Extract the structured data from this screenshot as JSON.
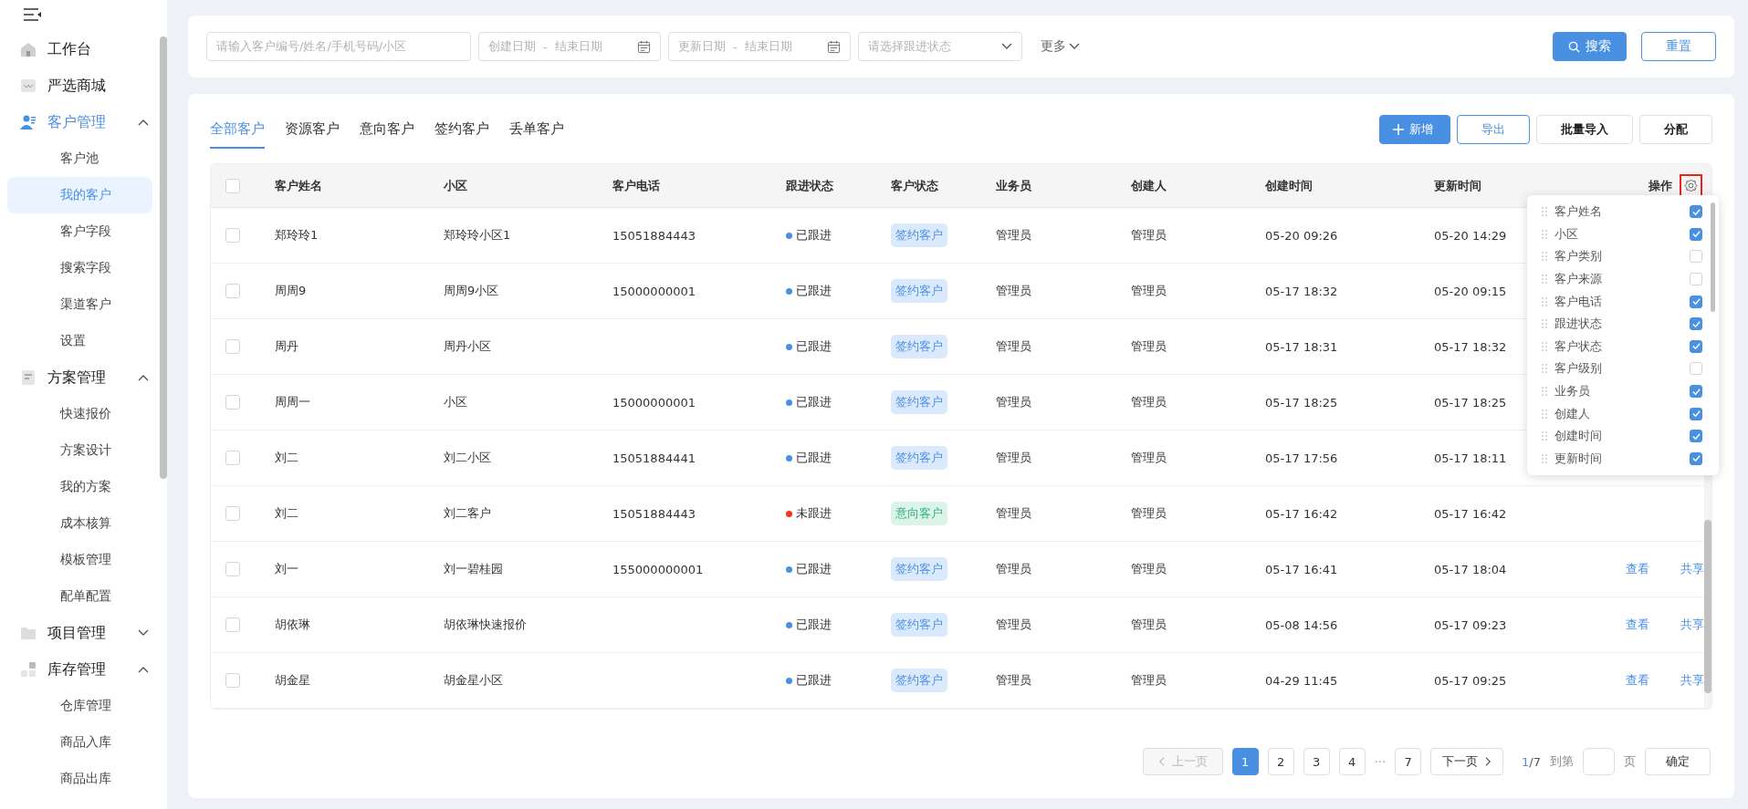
{
  "sidebar": {
    "items": [
      {
        "label": "工作台"
      },
      {
        "label": "严选商城"
      },
      {
        "label": "客户管理",
        "active": true,
        "expanded": true,
        "children": [
          {
            "label": "客户池",
            "selected": false
          },
          {
            "label": "我的客户",
            "selected": true
          },
          {
            "label": "客户字段",
            "selected": false
          },
          {
            "label": "搜索字段",
            "selected": false
          },
          {
            "label": "渠道客户",
            "selected": false
          },
          {
            "label": "设置",
            "selected": false
          }
        ]
      },
      {
        "label": "方案管理",
        "active": false,
        "expanded": true,
        "children": [
          {
            "label": "快速报价",
            "selected": false
          },
          {
            "label": "方案设计",
            "selected": false
          },
          {
            "label": "我的方案",
            "selected": false
          },
          {
            "label": "成本核算",
            "selected": false
          },
          {
            "label": "模板管理",
            "selected": false
          },
          {
            "label": "配单配置",
            "selected": false
          }
        ]
      },
      {
        "label": "项目管理",
        "active": false,
        "expanded": false
      },
      {
        "label": "库存管理",
        "active": false,
        "expanded": true,
        "children": [
          {
            "label": "仓库管理",
            "selected": false
          },
          {
            "label": "商品入库",
            "selected": false
          },
          {
            "label": "商品出库",
            "selected": false
          }
        ]
      }
    ]
  },
  "filters": {
    "search": {
      "placeholder": "请输入客户编号/姓名/手机号码/小区"
    },
    "date_ranges": [
      {
        "start_placeholder": "创建日期",
        "separator": "-",
        "end_placeholder": "结束日期"
      },
      {
        "start_placeholder": "更新日期",
        "separator": "-",
        "end_placeholder": "结束日期"
      }
    ],
    "status_select": {
      "placeholder": "请选择跟进状态"
    },
    "more": "更多",
    "search_button": "搜索",
    "reset_button": "重置"
  },
  "tabs": [
    {
      "label": "全部客户",
      "selected": true
    },
    {
      "label": "资源客户",
      "selected": false
    },
    {
      "label": "意向客户",
      "selected": false
    },
    {
      "label": "签约客户",
      "selected": false
    },
    {
      "label": "丢单客户",
      "selected": false
    }
  ],
  "actions": [
    {
      "label": "新增",
      "kind": "primary"
    },
    {
      "label": "导出",
      "kind": "outline"
    },
    {
      "label": "批量导入",
      "kind": "default"
    },
    {
      "label": "分配",
      "kind": "default"
    }
  ],
  "table": {
    "all_checked": false,
    "columns": [
      "客户姓名",
      "小区",
      "客户电话",
      "跟进状态",
      "客户状态",
      "业务员",
      "创建人",
      "创建时间",
      "更新时间",
      "操作"
    ],
    "rows": [
      {
        "checked": false,
        "name": "郑玲玲1",
        "community": "郑玲玲小区1",
        "phone": "15051884443",
        "follow": {
          "label": "已跟进",
          "color": "#4a90e2"
        },
        "status": {
          "label": "签约客户",
          "kind": "signed"
        },
        "salesperson": "管理员",
        "creator": "管理员",
        "created": "05-20 09:26",
        "updated": "05-20 14:29"
      },
      {
        "checked": false,
        "name": "周周9",
        "community": "周周9小区",
        "phone": "15000000001",
        "follow": {
          "label": "已跟进",
          "color": "#4a90e2"
        },
        "status": {
          "label": "签约客户",
          "kind": "signed"
        },
        "salesperson": "管理员",
        "creator": "管理员",
        "created": "05-17 18:32",
        "updated": "05-20 09:15"
      },
      {
        "checked": false,
        "name": "周丹",
        "community": "周丹小区",
        "follow": {
          "label": "已跟进",
          "color": "#4a90e2"
        },
        "status": {
          "label": "签约客户",
          "kind": "signed"
        },
        "salesperson": "管理员",
        "creator": "管理员",
        "created": "05-17 18:31",
        "updated": "05-17 18:32"
      },
      {
        "checked": false,
        "name": "周周一",
        "community": "小区",
        "phone": "15000000001",
        "follow": {
          "label": "已跟进",
          "color": "#4a90e2"
        },
        "status": {
          "label": "签约客户",
          "kind": "signed"
        },
        "salesperson": "管理员",
        "creator": "管理员",
        "created": "05-17 18:25",
        "updated": "05-17 18:25"
      },
      {
        "checked": false,
        "name": "刘二",
        "community": "刘二小区",
        "phone": "15051884441",
        "follow": {
          "label": "已跟进",
          "color": "#4a90e2"
        },
        "status": {
          "label": "签约客户",
          "kind": "signed"
        },
        "salesperson": "管理员",
        "creator": "管理员",
        "created": "05-17 17:56",
        "updated": "05-17 18:11"
      },
      {
        "checked": false,
        "name": "刘二",
        "community": "刘二客户",
        "phone": "15051884443",
        "follow": {
          "label": "未跟进",
          "color": "#f5341b"
        },
        "status": {
          "label": "意向客户",
          "kind": "intent"
        },
        "salesperson": "管理员",
        "creator": "管理员",
        "created": "05-17 16:42",
        "updated": "05-17 16:42"
      },
      {
        "checked": false,
        "name": "刘一",
        "community": "刘一碧桂园",
        "phone": "155000000001",
        "follow": {
          "label": "已跟进",
          "color": "#4a90e2"
        },
        "status": {
          "label": "签约客户",
          "kind": "signed"
        },
        "salesperson": "管理员",
        "creator": "管理员",
        "created": "05-17 16:41",
        "updated": "05-17 18:04",
        "ops": [
          "查看",
          "共享"
        ]
      },
      {
        "checked": false,
        "name": "胡依琳",
        "community": "胡依琳快速报价",
        "follow": {
          "label": "已跟进",
          "color": "#4a90e2"
        },
        "status": {
          "label": "签约客户",
          "kind": "signed"
        },
        "salesperson": "管理员",
        "creator": "管理员",
        "created": "05-08 14:56",
        "updated": "05-17 09:23",
        "ops": [
          "查看",
          "共享"
        ]
      },
      {
        "checked": false,
        "name": "胡金星",
        "community": "胡金星小区",
        "follow": {
          "label": "已跟进",
          "color": "#4a90e2"
        },
        "status": {
          "label": "签约客户",
          "kind": "signed"
        },
        "salesperson": "管理员",
        "creator": "管理员",
        "created": "04-29 11:45",
        "updated": "05-17 09:25",
        "ops": [
          "查看",
          "共享"
        ]
      }
    ]
  },
  "column_picker": {
    "items": [
      {
        "label": "客户姓名",
        "checked": true
      },
      {
        "label": "小区",
        "checked": true
      },
      {
        "label": "客户类别",
        "checked": false
      },
      {
        "label": "客户来源",
        "checked": false
      },
      {
        "label": "客户电话",
        "checked": true
      },
      {
        "label": "跟进状态",
        "checked": true
      },
      {
        "label": "客户状态",
        "checked": true
      },
      {
        "label": "客户级别",
        "checked": false
      },
      {
        "label": "业务员",
        "checked": true
      },
      {
        "label": "创建人",
        "checked": true
      },
      {
        "label": "创建时间",
        "checked": true
      },
      {
        "label": "更新时间",
        "checked": true
      }
    ]
  },
  "pagination": {
    "prev": "上一页",
    "pages": [
      {
        "label": "1",
        "selected": true
      },
      {
        "label": "2",
        "selected": false
      },
      {
        "label": "3",
        "selected": false
      },
      {
        "label": "4",
        "selected": false
      },
      {
        "label": "···",
        "kind": "ellipsis",
        "selected": false
      },
      {
        "label": "7",
        "selected": false
      }
    ],
    "next": "下一页",
    "current": "1",
    "total": "/7",
    "goto_label": "到第",
    "page_unit": "页",
    "confirm": "确定"
  }
}
